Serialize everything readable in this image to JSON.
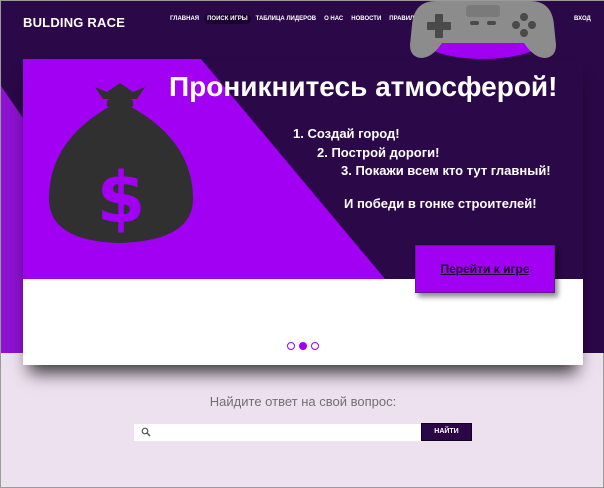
{
  "header": {
    "logo": "BULDING RACE",
    "nav": [
      {
        "label": "ГЛАВНАЯ"
      },
      {
        "label": "ПОИСК ИГРЫ",
        "active": true
      },
      {
        "label": "ТАБЛИЦА ЛИДЕРОВ"
      },
      {
        "label": "О НАС"
      },
      {
        "label": "НОВОСТИ"
      },
      {
        "label": "ПРАВИЛА"
      }
    ],
    "login": "ВХОД",
    "decor_icon": "gamepad-icon"
  },
  "banner": {
    "title": "Проникнитесь атмосферой!",
    "steps": [
      "1. Создай город!",
      "2. Построй дороги!",
      "3. Покажи всем кто тут главный!"
    ],
    "tagline": "И победи в гонке строителей!",
    "cta": "Перейти к игре",
    "image_icon": "money-bag-icon",
    "slides_count": 3,
    "active_slide": 2
  },
  "search": {
    "title": "Найдите ответ на свой вопрос:",
    "placeholder": "",
    "button": "НАЙТИ",
    "icon": "search-icon"
  },
  "colors": {
    "accent": "#a100f2",
    "dark": "#2b0847",
    "page_bg": "#ede0ef"
  }
}
